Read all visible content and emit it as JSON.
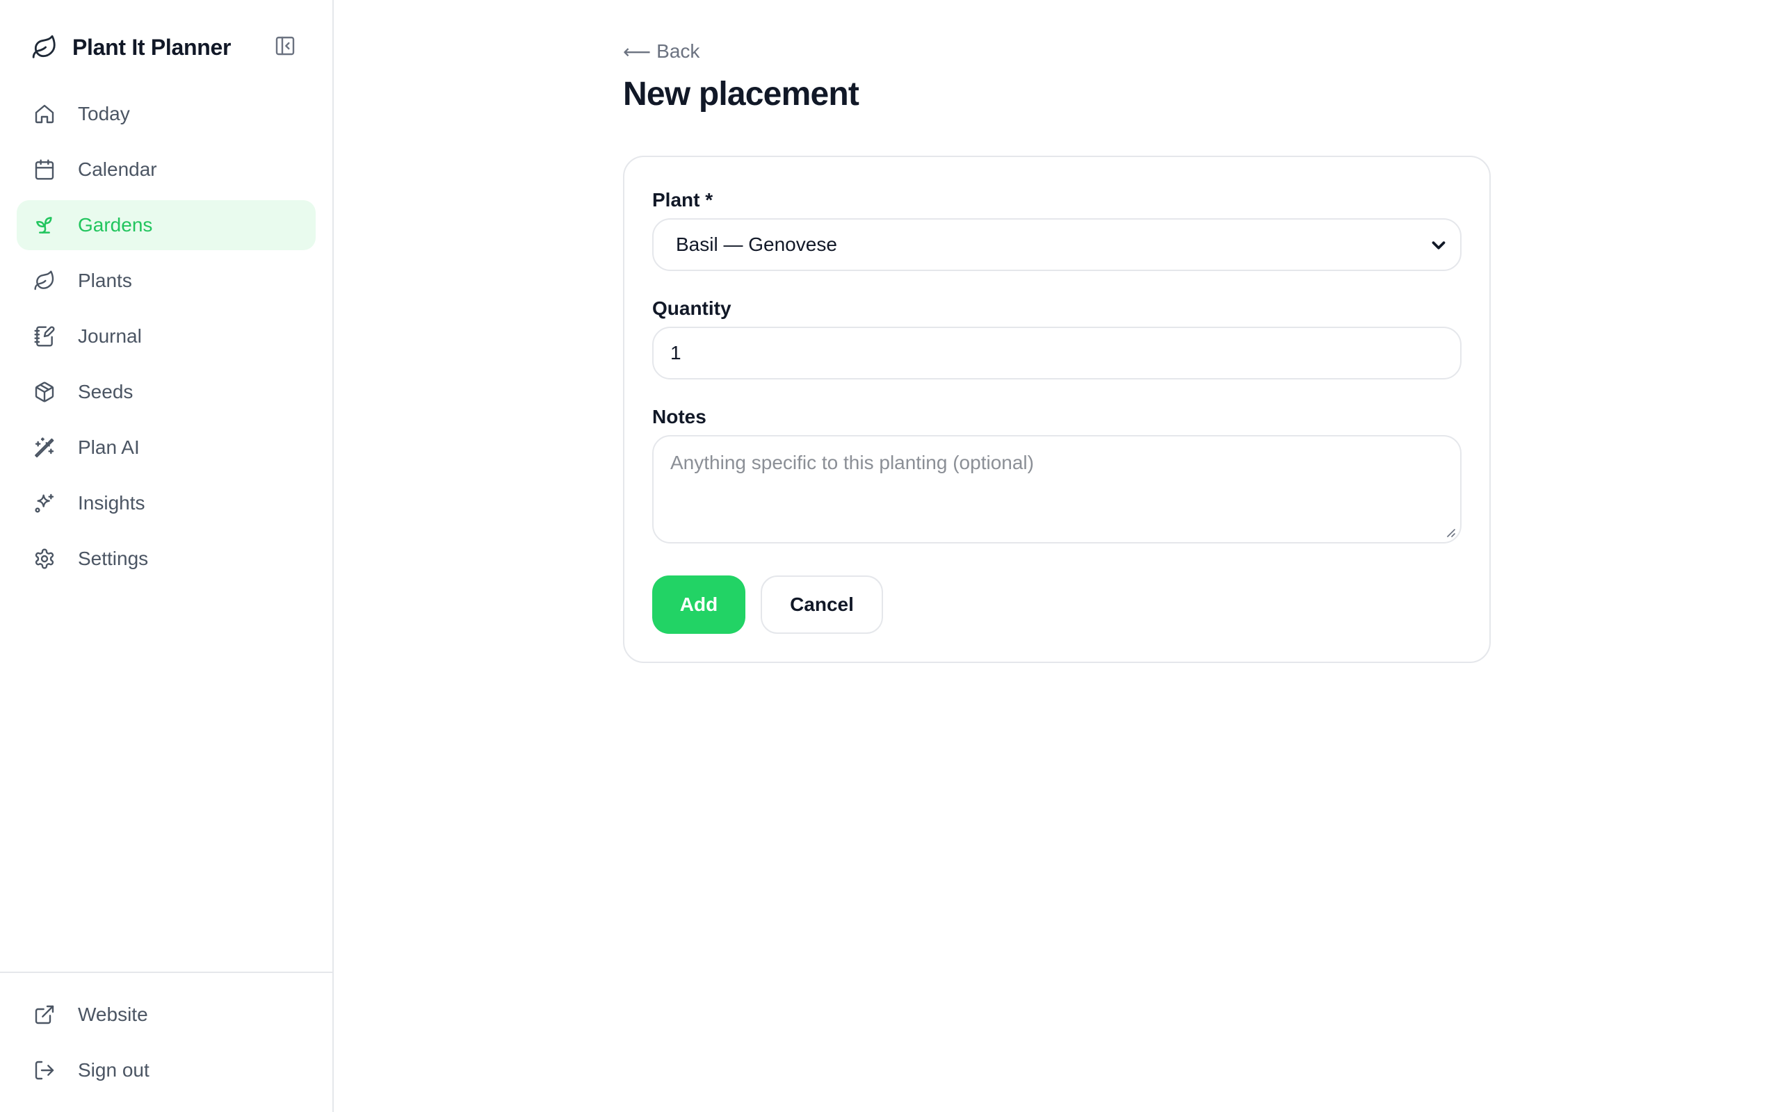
{
  "sidebar": {
    "app_title": "Plant It Planner",
    "logo_icon": "leaf-icon",
    "collapse_icon": "panel-collapse-icon",
    "items": [
      {
        "label": "Today",
        "icon": "home-icon",
        "active": false
      },
      {
        "label": "Calendar",
        "icon": "calendar-icon",
        "active": false
      },
      {
        "label": "Gardens",
        "icon": "sprout-icon",
        "active": true
      },
      {
        "label": "Plants",
        "icon": "leaf-icon",
        "active": false
      },
      {
        "label": "Journal",
        "icon": "notebook-pen-icon",
        "active": false
      },
      {
        "label": "Seeds",
        "icon": "package-icon",
        "active": false
      },
      {
        "label": "Plan AI",
        "icon": "magic-wand-icon",
        "active": false
      },
      {
        "label": "Insights",
        "icon": "sparkles-icon",
        "active": false
      },
      {
        "label": "Settings",
        "icon": "gear-icon",
        "active": false
      }
    ],
    "bottom_items": [
      {
        "label": "Website",
        "icon": "external-link-icon"
      },
      {
        "label": "Sign out",
        "icon": "log-out-icon"
      }
    ]
  },
  "main": {
    "back_label": "Back",
    "back_arrow": "⟵",
    "page_title": "New placement",
    "form": {
      "plant_label": "Plant *",
      "plant_value": "Basil — Genovese",
      "quantity_label": "Quantity",
      "quantity_value": "1",
      "notes_label": "Notes",
      "notes_placeholder": "Anything specific to this planting (optional)",
      "add_label": "Add",
      "cancel_label": "Cancel"
    }
  },
  "colors": {
    "accent": "#22d365",
    "active_bg": "#e9fbee",
    "active_text": "#22c55e",
    "border": "#e5e7eb",
    "muted_text": "#6b7280"
  }
}
